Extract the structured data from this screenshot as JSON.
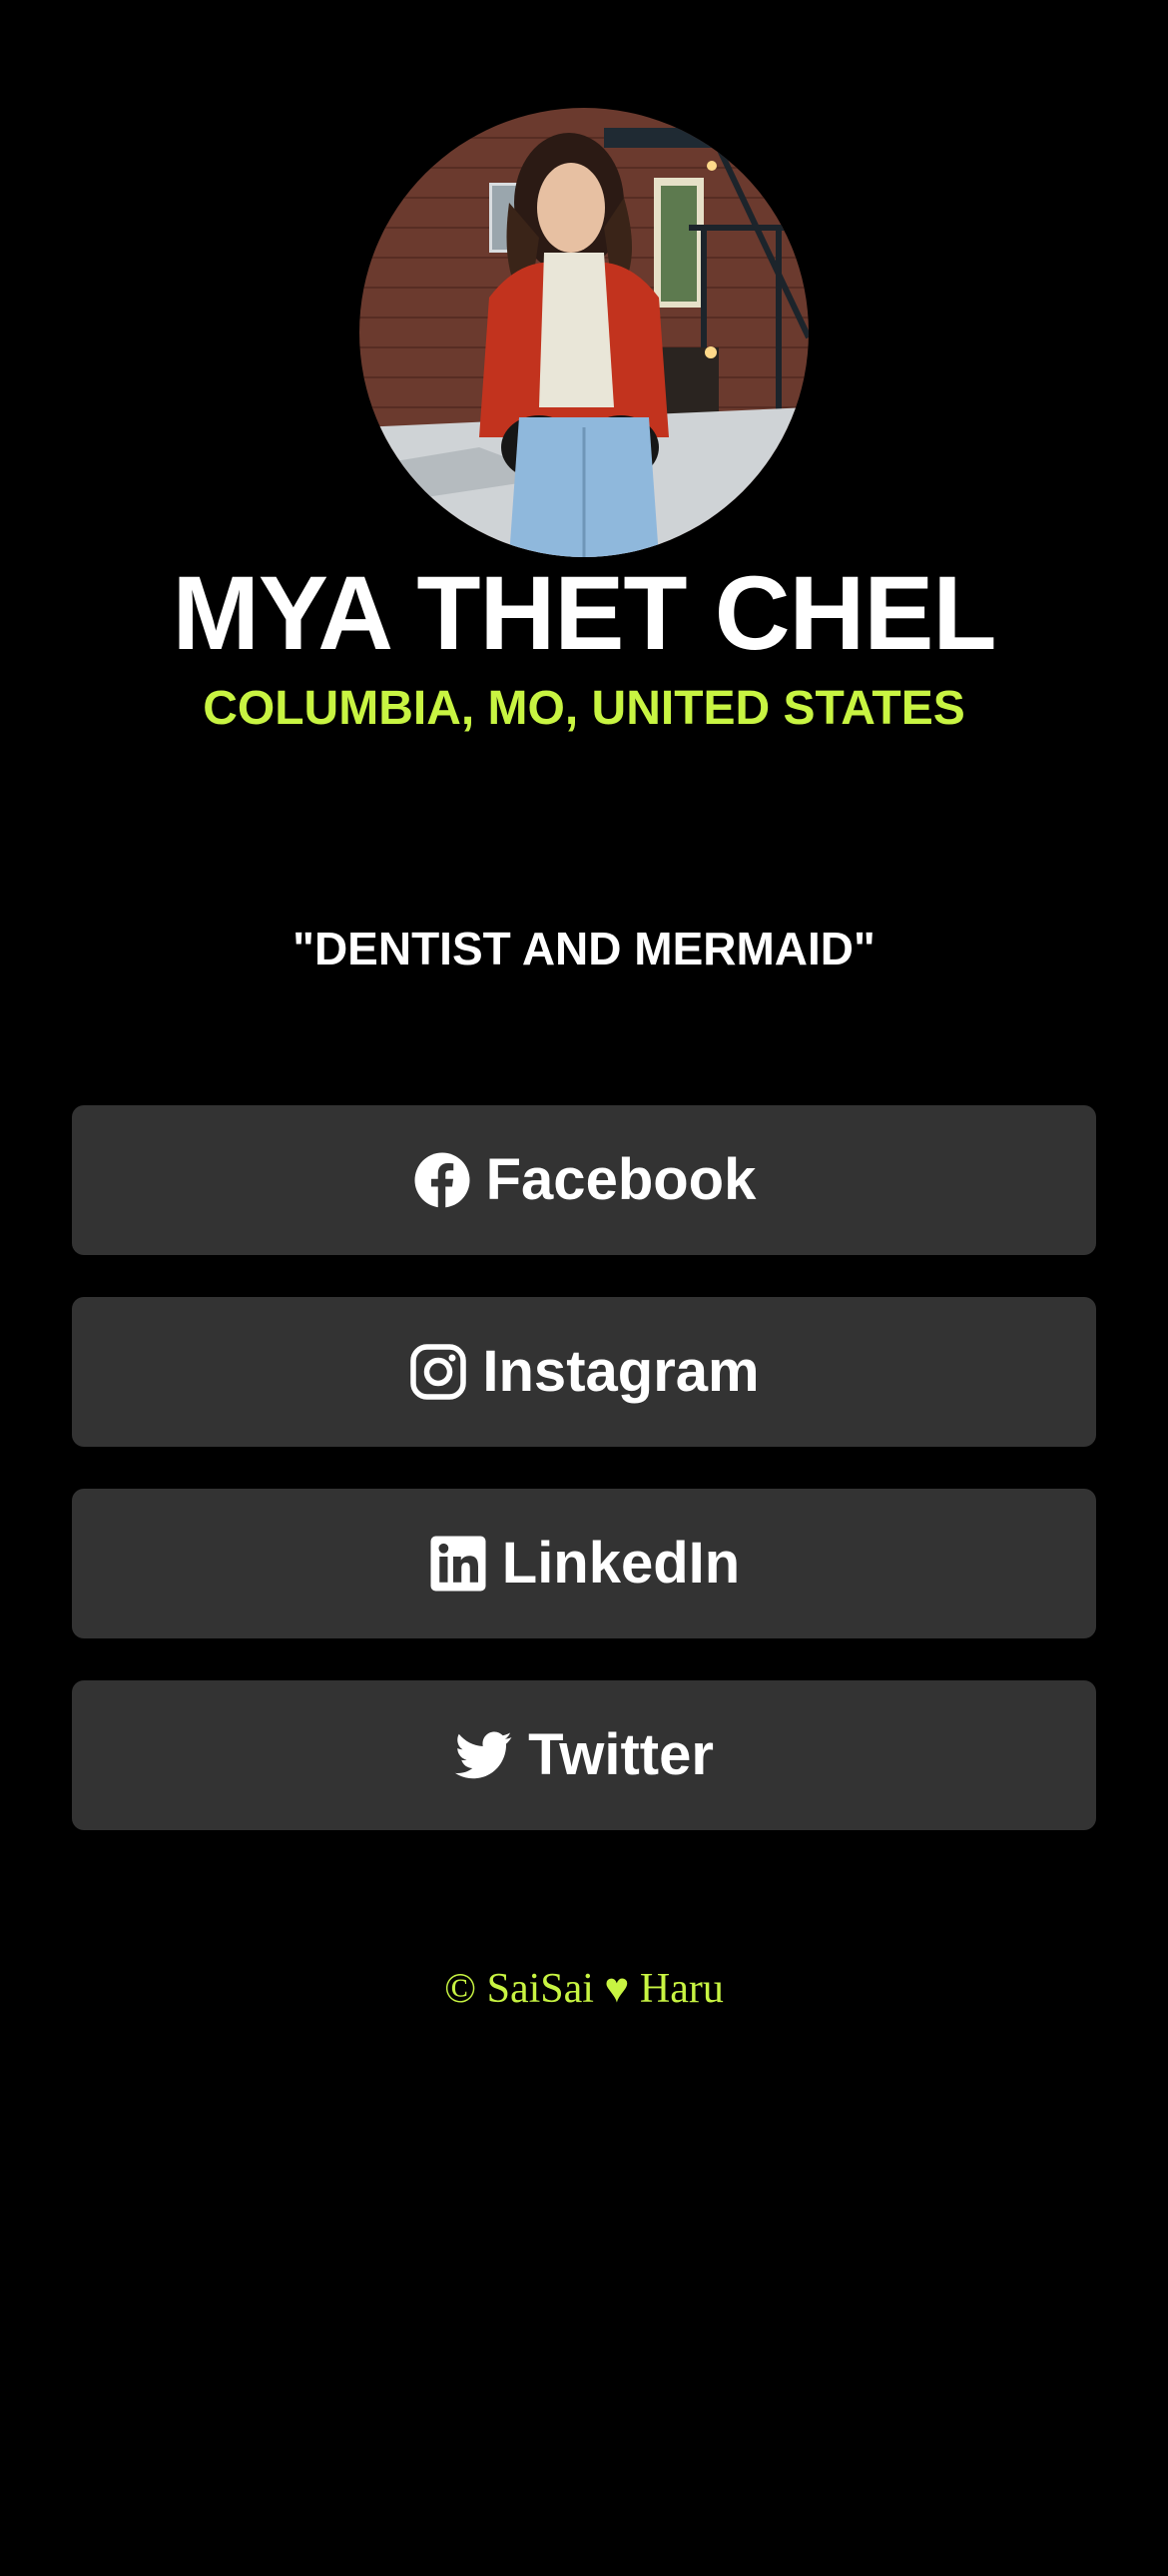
{
  "profile": {
    "name": "MYA THET CHEL",
    "location": "COLUMBIA, MO, UNITED STATES",
    "tagline": "\"DENTIST AND MERMAID\""
  },
  "links": [
    {
      "label": "Facebook",
      "icon": "facebook-icon"
    },
    {
      "label": "Instagram",
      "icon": "instagram-icon"
    },
    {
      "label": "LinkedIn",
      "icon": "linkedin-icon"
    },
    {
      "label": "Twitter",
      "icon": "twitter-icon"
    }
  ],
  "footer": {
    "text": "© SaiSai ♥ Haru"
  },
  "colors": {
    "background": "#000000",
    "accent": "#c8f442",
    "button": "#333333",
    "text": "#ffffff"
  }
}
